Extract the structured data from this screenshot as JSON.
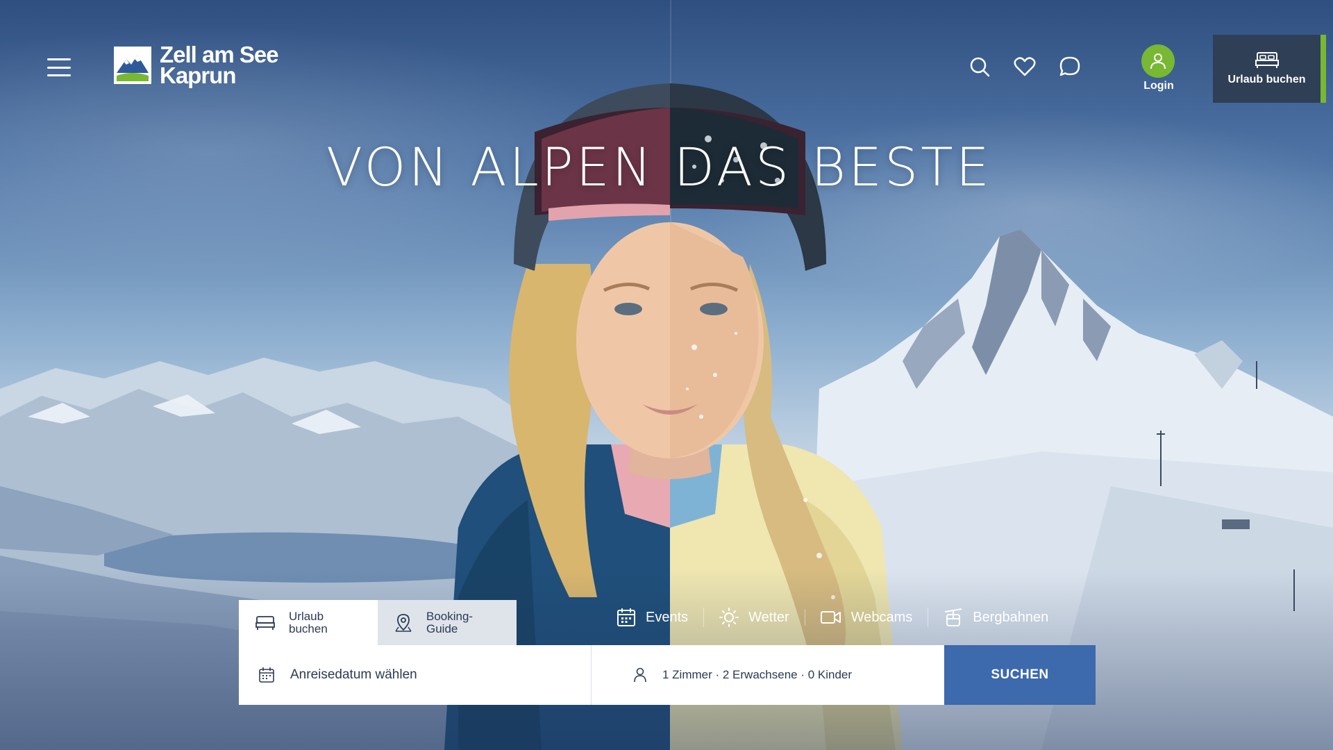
{
  "header": {
    "logo_line1": "Zell am See",
    "logo_line2": "Kaprun",
    "login_label": "Login",
    "book_label": "Urlaub buchen"
  },
  "hero": {
    "headline": "VON ALPEN DAS BESTE"
  },
  "booking": {
    "tabs": [
      {
        "label": "Urlaub\nbuchen",
        "icon": "bed-icon"
      },
      {
        "label": "Booking-\nGuide",
        "icon": "map-pin-icon"
      }
    ],
    "date_placeholder": "Anreisedatum wählen",
    "guests_value": "1 Zimmer · 2 Erwachsene · 0 Kinder",
    "search_label": "SUCHEN"
  },
  "quicklinks": [
    {
      "label": "Events",
      "icon": "calendar-icon"
    },
    {
      "label": "Wetter",
      "icon": "sun-icon"
    },
    {
      "label": "Webcams",
      "icon": "video-camera-icon"
    },
    {
      "label": "Bergbahnen",
      "icon": "gondola-icon"
    }
  ],
  "colors": {
    "accent_green": "#78b833",
    "button_blue": "#3d69ad",
    "dark_panel": "#2e3f56"
  }
}
